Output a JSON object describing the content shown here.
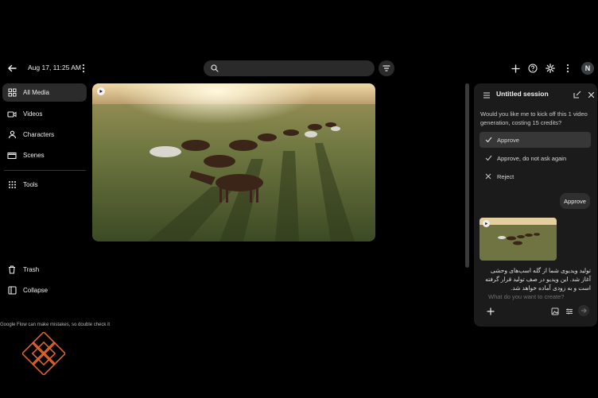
{
  "header": {
    "datetime": "Aug 17, 11:25 AM",
    "search_placeholder": "",
    "avatar_initial": "N"
  },
  "sidebar": {
    "items": [
      {
        "label": "All Media",
        "icon": "grid-icon"
      },
      {
        "label": "Videos",
        "icon": "video-icon"
      },
      {
        "label": "Characters",
        "icon": "person-icon"
      },
      {
        "label": "Scenes",
        "icon": "film-icon"
      },
      {
        "label": "Tools",
        "icon": "apps-icon"
      }
    ],
    "bottom": [
      {
        "label": "Trash",
        "icon": "trash-icon"
      },
      {
        "label": "Collapse",
        "icon": "collapse-icon"
      }
    ],
    "disclaimer": "Google Flow can make mistakes, so double check it"
  },
  "session": {
    "title": "Untitled session",
    "question": "Would you like me to kick off this 1 video generation, costing 15 credits?",
    "options": [
      "Approve",
      "Approve, do not ask again",
      "Reject"
    ],
    "user_reply": "Approve",
    "assistant_reply": "تولید ویدیوی شما از گله اسب‌های وحشی آغاز شد. این ویدیو در صف تولید قرار گرفته است و به زودی آماده خواهد شد.",
    "prompt_placeholder": "What do you want to create?"
  },
  "colors": {
    "background": "#000000",
    "panel": "#1b1b1b",
    "accent_logo": "#e0632a"
  }
}
